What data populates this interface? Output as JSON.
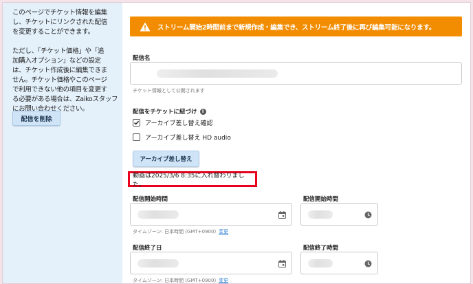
{
  "sidebar": {
    "paragraph1": "このページでチケット情報を編集\nし、チケットにリンクされた配信\nを変更することができます。",
    "paragraph2": "ただし、「チケット価格」や「追\n加購入オプション」などの設定\nは、チケット作成後に編集できま\nせん。チケット価格やこのページ\nで利用できない他の項目を変更す\nる必要がある場合は、Zaikoスタッフ\nにお問い合わせください。",
    "delete_button": "配信を削除"
  },
  "alert": {
    "text": "ストリーム開始2時間前まで新規作成・編集でき、ストリーム終了後に再び編集可能になります。",
    "icon": "warning-icon",
    "color": "#f28c00"
  },
  "stream_name": {
    "label": "配信名",
    "helper": "チケット情報として公開されます"
  },
  "link": {
    "label": "配信をチケットに紐づけ",
    "options": [
      {
        "label": "アーカイブ差し替え確認",
        "checked": true
      },
      {
        "label": "アーカイブ差し替え HD audio",
        "checked": false
      }
    ],
    "swap_button": "アーカイブ差し替え"
  },
  "notice": {
    "text": "動画は2025/3/6 8:35に入れ替わりました。",
    "border_color": "#e8001c"
  },
  "start": {
    "date_label": "配信開始時間",
    "time_label": "配信開始時間",
    "timezone": "タイムゾーン: 日本時間 (GMT+0900)",
    "change_link": "変更"
  },
  "end": {
    "date_label": "配信終了日",
    "time_label": "配信終了時間",
    "timezone": "タイムゾーン: 日本時間 (GMT+0900)",
    "change_link": "変更"
  }
}
